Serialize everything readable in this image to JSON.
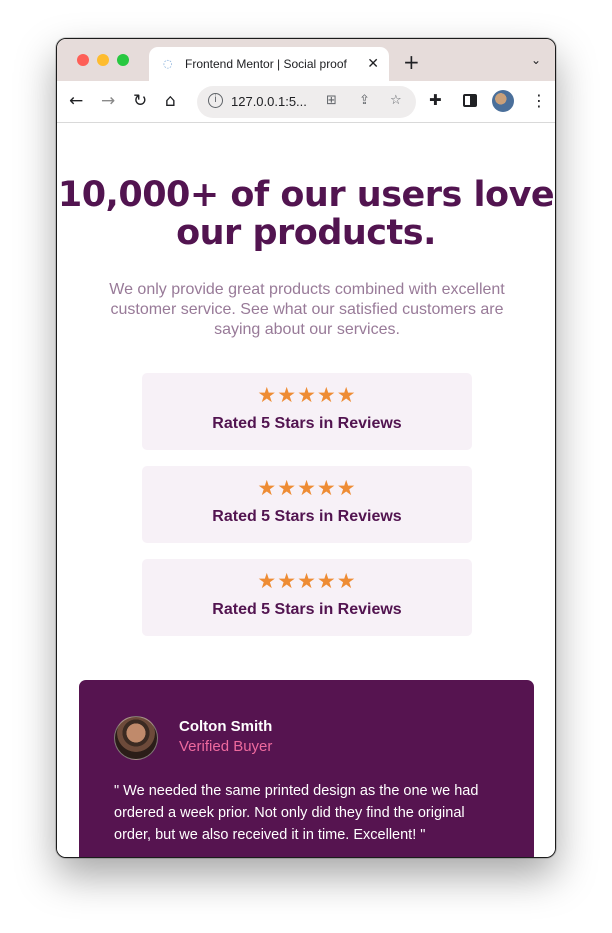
{
  "browser": {
    "tab_title": "Frontend Mentor | Social proof",
    "tab_close": "✕",
    "new_tab": "+",
    "url": "127.0.0.1:5..."
  },
  "page": {
    "headline": "10,000+ of our users love our products.",
    "subtext": "We only provide great products combined with excellent customer service. See what our satisfied customers are saying about our services.",
    "ratings": [
      {
        "stars": "★★★★★",
        "label": "Rated 5 Stars in Reviews"
      },
      {
        "stars": "★★★★★",
        "label": "Rated 5 Stars in Reviews"
      },
      {
        "stars": "★★★★★",
        "label": "Rated 5 Stars in Reviews"
      }
    ],
    "testimonial": {
      "name": "Colton Smith",
      "role": "Verified Buyer",
      "quote": "\" We needed the same printed design as the one we had ordered a week prior. Not only did they find the original order, but we also received it in time. Excellent! \""
    }
  },
  "colors": {
    "primary": "#521450",
    "muted": "#987a98",
    "star": "#ee8c34",
    "card_bg": "#f7f1f7",
    "testimonial_bg": "#561450",
    "accent_pink": "#ee6a9e"
  },
  "icons": [
    "back-icon",
    "forward-icon",
    "reload-icon",
    "home-icon",
    "info-icon",
    "translate-icon",
    "share-icon",
    "bookmark-star-icon",
    "extensions-icon",
    "side-panel-icon",
    "profile-avatar",
    "more-menu-icon",
    "star-icon"
  ]
}
